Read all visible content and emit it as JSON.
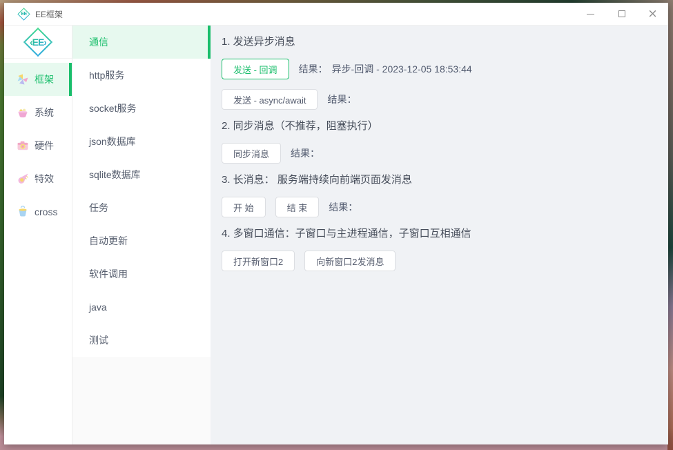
{
  "colors": {
    "accent": "#19be6b",
    "accent_bg": "#e7f9ef",
    "text": "#515a6e",
    "main_bg": "#f0f2f5"
  },
  "window": {
    "title": "EE框架",
    "app_icon": "ee-diamond-icon",
    "controls": [
      "minimize",
      "maximize",
      "close"
    ]
  },
  "logo": {
    "text": "‹EE›"
  },
  "primary_nav": {
    "items": [
      {
        "label": "框架",
        "icon": "pinwheel-icon",
        "active": true
      },
      {
        "label": "系统",
        "icon": "basket-icon",
        "active": false
      },
      {
        "label": "硬件",
        "icon": "camera-icon",
        "active": false
      },
      {
        "label": "特效",
        "icon": "comet-icon",
        "active": false
      },
      {
        "label": "cross",
        "icon": "bucket-icon",
        "active": false
      }
    ]
  },
  "secondary_nav": {
    "items": [
      {
        "label": "通信",
        "active": true
      },
      {
        "label": "http服务",
        "active": false
      },
      {
        "label": "socket服务",
        "active": false
      },
      {
        "label": "json数据库",
        "active": false
      },
      {
        "label": "sqlite数据库",
        "active": false
      },
      {
        "label": "任务",
        "active": false
      },
      {
        "label": "自动更新",
        "active": false
      },
      {
        "label": "软件调用",
        "active": false
      },
      {
        "label": "java",
        "active": false
      },
      {
        "label": "测试",
        "active": false
      }
    ]
  },
  "main": {
    "sections": [
      {
        "heading": "1. 发送异步消息",
        "rows": [
          {
            "buttons": [
              {
                "label": "发送 - 回调",
                "style": "success"
              }
            ],
            "result_label": "结果：",
            "result_value": "异步-回调 - 2023-12-05 18:53:44"
          },
          {
            "buttons": [
              {
                "label": "发送 - async/await",
                "style": "default"
              }
            ],
            "result_label": "结果：",
            "result_value": ""
          }
        ]
      },
      {
        "heading": "2. 同步消息（不推荐，阻塞执行）",
        "rows": [
          {
            "buttons": [
              {
                "label": "同步消息",
                "style": "default"
              }
            ],
            "result_label": "结果：",
            "result_value": ""
          }
        ]
      },
      {
        "heading": "3. 长消息： 服务端持续向前端页面发消息",
        "rows": [
          {
            "buttons": [
              {
                "label": "开 始",
                "style": "default"
              },
              {
                "label": "结 束",
                "style": "default"
              }
            ],
            "result_label": "结果：",
            "result_value": ""
          }
        ]
      },
      {
        "heading": "4. 多窗口通信：子窗口与主进程通信，子窗口互相通信",
        "rows": [
          {
            "buttons": [
              {
                "label": "打开新窗口2",
                "style": "default"
              },
              {
                "label": "向新窗口2发消息",
                "style": "default"
              }
            ],
            "result_label": "",
            "result_value": ""
          }
        ]
      }
    ]
  }
}
